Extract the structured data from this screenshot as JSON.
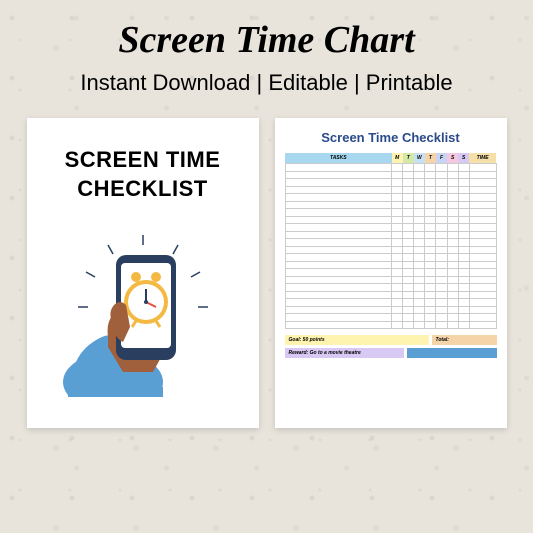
{
  "header": {
    "title": "Screen Time Chart",
    "subtitle": "Instant Download | Editable | Printable"
  },
  "left_page": {
    "title_line1": "SCREEN TIME",
    "title_line2": "CHECKLIST"
  },
  "right_page": {
    "title": "Screen Time Checklist",
    "columns": {
      "tasks": "TASKS",
      "m": "M",
      "t1": "T",
      "w": "W",
      "t2": "T",
      "f": "F",
      "s1": "S",
      "s2": "S",
      "time": "TIME"
    },
    "row_count": 22,
    "goal": "Goal: 50 points",
    "total": "Total:",
    "reward": "Reward: Go to a movie theatre"
  }
}
